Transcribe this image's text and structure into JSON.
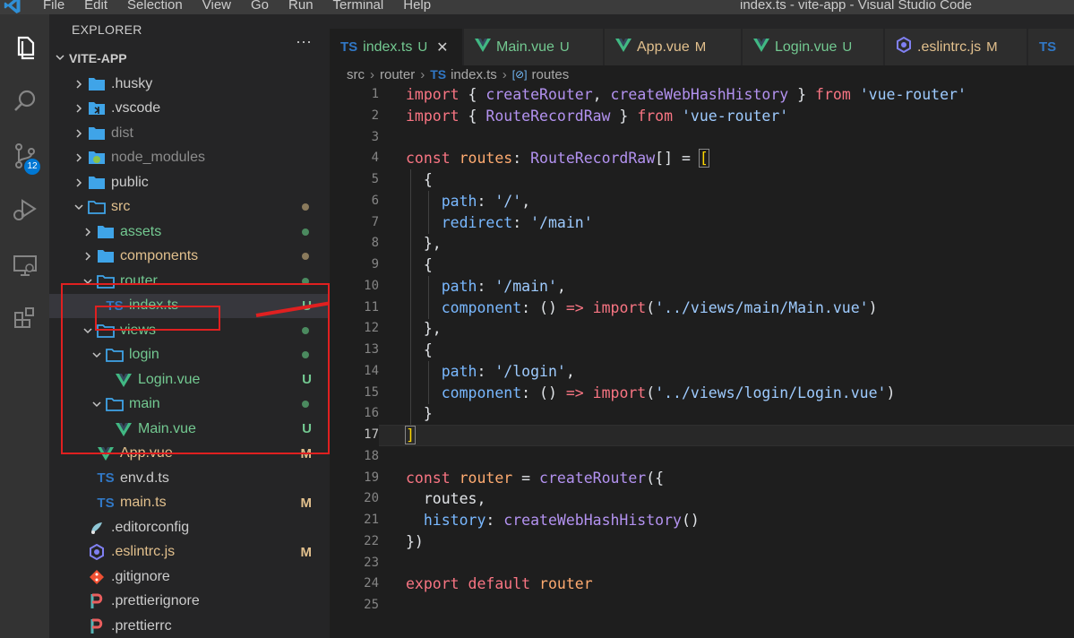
{
  "window": {
    "title": "index.ts - vite-app - Visual Studio Code",
    "menu": [
      "File",
      "Edit",
      "Selection",
      "View",
      "Go",
      "Run",
      "Terminal",
      "Help"
    ]
  },
  "activity_bar": {
    "items": [
      "explorer-icon",
      "search-icon",
      "source-control-icon",
      "run-debug-icon",
      "remote-explorer-icon",
      "extensions-icon"
    ],
    "source_control_badge": "12"
  },
  "sidebar": {
    "title": "EXPLORER",
    "more_actions": "···",
    "section": "VITE-APP",
    "tree": [
      {
        "name": ".husky",
        "type": "folder",
        "depth": 0,
        "expanded": false,
        "status": ""
      },
      {
        "name": ".vscode",
        "type": "folder-vscode",
        "depth": 0,
        "expanded": false,
        "status": ""
      },
      {
        "name": "dist",
        "type": "folder",
        "depth": 0,
        "expanded": false,
        "status": "",
        "muted": true
      },
      {
        "name": "node_modules",
        "type": "folder-node",
        "depth": 0,
        "expanded": false,
        "status": "",
        "muted": true
      },
      {
        "name": "public",
        "type": "folder",
        "depth": 0,
        "expanded": false,
        "status": ""
      },
      {
        "name": "src",
        "type": "folder-open",
        "depth": 0,
        "expanded": true,
        "status": "dot-brown"
      },
      {
        "name": "assets",
        "type": "folder",
        "depth": 1,
        "expanded": false,
        "status": "dot-green"
      },
      {
        "name": "components",
        "type": "folder",
        "depth": 1,
        "expanded": false,
        "status": "dot-brown"
      },
      {
        "name": "router",
        "type": "folder-open",
        "depth": 1,
        "expanded": true,
        "status": "dot-green"
      },
      {
        "name": "index.ts",
        "type": "ts",
        "depth": 2,
        "status": "U",
        "selected": true
      },
      {
        "name": "views",
        "type": "folder-open",
        "depth": 1,
        "expanded": true,
        "status": "dot-green"
      },
      {
        "name": "login",
        "type": "folder-open",
        "depth": 2,
        "expanded": true,
        "status": "dot-green"
      },
      {
        "name": "Login.vue",
        "type": "vue",
        "depth": 3,
        "status": "U"
      },
      {
        "name": "main",
        "type": "folder-open",
        "depth": 2,
        "expanded": true,
        "status": "dot-green"
      },
      {
        "name": "Main.vue",
        "type": "vue",
        "depth": 3,
        "status": "U"
      },
      {
        "name": "App.vue",
        "type": "vue",
        "depth": 1,
        "status": "M"
      },
      {
        "name": "env.d.ts",
        "type": "ts",
        "depth": 1,
        "status": ""
      },
      {
        "name": "main.ts",
        "type": "ts",
        "depth": 1,
        "status": "M"
      },
      {
        "name": ".editorconfig",
        "type": "editorconfig",
        "depth": 0,
        "status": ""
      },
      {
        "name": ".eslintrc.js",
        "type": "eslint",
        "depth": 0,
        "status": "M"
      },
      {
        "name": ".gitignore",
        "type": "git",
        "depth": 0,
        "status": ""
      },
      {
        "name": ".prettierignore",
        "type": "prettier",
        "depth": 0,
        "status": ""
      },
      {
        "name": ".prettierrc",
        "type": "prettier",
        "depth": 0,
        "status": ""
      }
    ]
  },
  "tabs": [
    {
      "name": "index.ts",
      "type": "ts",
      "status": "U",
      "active": true,
      "close": "✕"
    },
    {
      "name": "Main.vue",
      "type": "vue",
      "status": "U"
    },
    {
      "name": "App.vue",
      "type": "vue",
      "status": "M"
    },
    {
      "name": "Login.vue",
      "type": "vue",
      "status": "U"
    },
    {
      "name": ".eslintrc.js",
      "type": "eslint",
      "status": "M"
    },
    {
      "name": "",
      "type": "ts",
      "status": ""
    }
  ],
  "breadcrumb": {
    "parts": [
      "src",
      "router",
      "index.ts",
      "routes"
    ],
    "separator": "›"
  },
  "editor": {
    "current_line": 17,
    "lines": [
      [
        [
          "kw",
          "import"
        ],
        [
          "p",
          " { "
        ],
        [
          "fn",
          "createRouter"
        ],
        [
          "p",
          ", "
        ],
        [
          "fn",
          "createWebHashHistory"
        ],
        [
          "p",
          " } "
        ],
        [
          "kw",
          "from"
        ],
        [
          "p",
          " "
        ],
        [
          "st",
          "'vue-router'"
        ]
      ],
      [
        [
          "kw",
          "import"
        ],
        [
          "p",
          " { "
        ],
        [
          "fn",
          "RouteRecordRaw"
        ],
        [
          "p",
          " } "
        ],
        [
          "kw",
          "from"
        ],
        [
          "p",
          " "
        ],
        [
          "st",
          "'vue-router'"
        ]
      ],
      [],
      [
        [
          "kw",
          "const"
        ],
        [
          "p",
          " "
        ],
        [
          "vr",
          "routes"
        ],
        [
          "p",
          ": "
        ],
        [
          "ty",
          "RouteRecordRaw"
        ],
        [
          "p",
          "[] = "
        ],
        [
          "br",
          "["
        ]
      ],
      [
        [
          "p",
          "  {"
        ]
      ],
      [
        [
          "p",
          "    "
        ],
        [
          "pr",
          "path"
        ],
        [
          "p",
          ": "
        ],
        [
          "st",
          "'/'"
        ],
        [
          "p",
          ","
        ]
      ],
      [
        [
          "p",
          "    "
        ],
        [
          "pr",
          "redirect"
        ],
        [
          "p",
          ": "
        ],
        [
          "st",
          "'/main'"
        ]
      ],
      [
        [
          "p",
          "  },"
        ]
      ],
      [
        [
          "p",
          "  {"
        ]
      ],
      [
        [
          "p",
          "    "
        ],
        [
          "pr",
          "path"
        ],
        [
          "p",
          ": "
        ],
        [
          "st",
          "'/main'"
        ],
        [
          "p",
          ","
        ]
      ],
      [
        [
          "p",
          "    "
        ],
        [
          "pr",
          "component"
        ],
        [
          "p",
          ": () "
        ],
        [
          "kw",
          "=>"
        ],
        [
          "p",
          " "
        ],
        [
          "kw",
          "import"
        ],
        [
          "p",
          "("
        ],
        [
          "st",
          "'../views/main/Main.vue'"
        ],
        [
          "p",
          ")"
        ]
      ],
      [
        [
          "p",
          "  },"
        ]
      ],
      [
        [
          "p",
          "  {"
        ]
      ],
      [
        [
          "p",
          "    "
        ],
        [
          "pr",
          "path"
        ],
        [
          "p",
          ": "
        ],
        [
          "st",
          "'/login'"
        ],
        [
          "p",
          ","
        ]
      ],
      [
        [
          "p",
          "    "
        ],
        [
          "pr",
          "component"
        ],
        [
          "p",
          ": () "
        ],
        [
          "kw",
          "=>"
        ],
        [
          "p",
          " "
        ],
        [
          "kw",
          "import"
        ],
        [
          "p",
          "("
        ],
        [
          "st",
          "'../views/login/Login.vue'"
        ],
        [
          "p",
          ")"
        ]
      ],
      [
        [
          "p",
          "  }"
        ]
      ],
      [
        [
          "br",
          "]"
        ]
      ],
      [],
      [
        [
          "kw",
          "const"
        ],
        [
          "p",
          " "
        ],
        [
          "vr",
          "router"
        ],
        [
          "p",
          " = "
        ],
        [
          "fn",
          "createRouter"
        ],
        [
          "p",
          "({"
        ]
      ],
      [
        [
          "p",
          "  routes,"
        ]
      ],
      [
        [
          "p",
          "  "
        ],
        [
          "pr",
          "history"
        ],
        [
          "p",
          ": "
        ],
        [
          "fn",
          "createWebHashHistory"
        ],
        [
          "p",
          "()"
        ]
      ],
      [
        [
          "p",
          "})"
        ]
      ],
      [],
      [
        [
          "kw",
          "export"
        ],
        [
          "p",
          " "
        ],
        [
          "kw",
          "default"
        ],
        [
          "p",
          " "
        ],
        [
          "vr",
          "router"
        ]
      ],
      []
    ]
  },
  "colors": {
    "keyword": "#f97583",
    "function": "#b392f0",
    "string": "#9ecbff",
    "variable": "#ffab70",
    "property": "#79b8ff",
    "punctuation": "#e1e4e8",
    "vue_green": "#41b883",
    "ts_blue": "#3178c6",
    "folder_blue": "#3fa4e8",
    "status_untracked": "#73c991",
    "status_modified": "#e2c08d",
    "annotation_red": "#e02020"
  }
}
